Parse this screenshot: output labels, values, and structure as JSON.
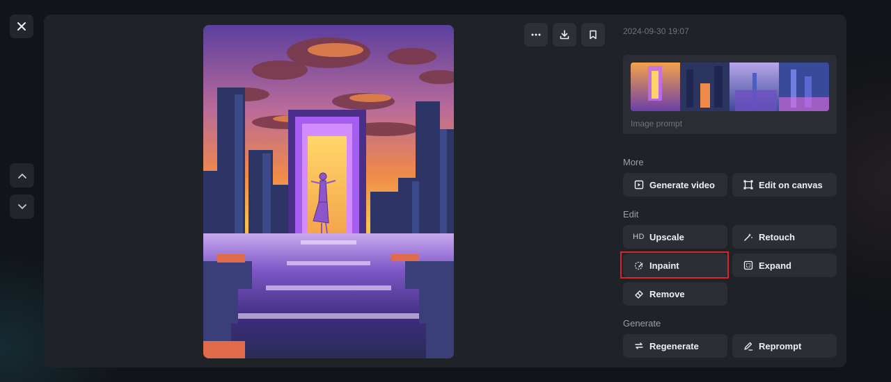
{
  "toolbar": {
    "close_icon": "close-icon",
    "more_icon": "more-icon",
    "download_icon": "download-icon",
    "bookmark_icon": "bookmark-icon"
  },
  "navigation": {
    "up_icon": "chevron-up-icon",
    "down_icon": "chevron-down-icon"
  },
  "details": {
    "timestamp": "2024-09-30 19:07",
    "image_prompt_label": "Image prompt"
  },
  "sections": {
    "more": {
      "label": "More",
      "buttons": [
        {
          "label": "Generate video",
          "icon": "generate-video-icon"
        },
        {
          "label": "Edit on canvas",
          "icon": "canvas-icon"
        }
      ]
    },
    "edit": {
      "label": "Edit",
      "buttons": [
        {
          "label": "Upscale",
          "icon": "hd-icon",
          "icon_text": "HD"
        },
        {
          "label": "Retouch",
          "icon": "retouch-icon"
        },
        {
          "label": "Inpaint",
          "icon": "inpaint-icon",
          "highlighted": true
        },
        {
          "label": "Expand",
          "icon": "expand-icon"
        },
        {
          "label": "Remove",
          "icon": "eraser-icon"
        }
      ]
    },
    "generate": {
      "label": "Generate",
      "buttons": [
        {
          "label": "Regenerate",
          "icon": "regenerate-icon"
        },
        {
          "label": "Reprompt",
          "icon": "pencil-icon"
        }
      ]
    }
  },
  "colors": {
    "panel": "#1f2227",
    "button": "#2b2f35",
    "highlight": "#d9262b"
  }
}
